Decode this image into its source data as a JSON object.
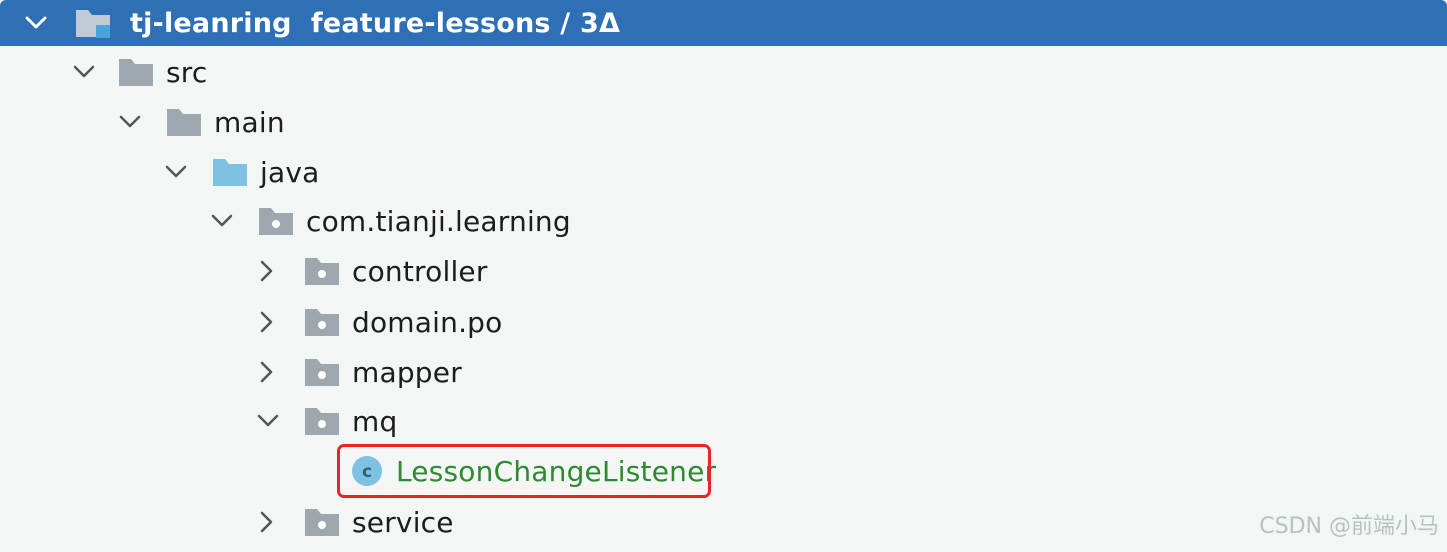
{
  "project": {
    "name": "tj-leanring",
    "branch_label": "feature-lessons / 3Δ"
  },
  "tree": {
    "src": "src",
    "main": "main",
    "java": "java",
    "package": "com.tianji.learning",
    "controller": "controller",
    "domain_po": "domain.po",
    "mapper": "mapper",
    "mq": "mq",
    "listener": "LessonChangeListener",
    "service": "service"
  },
  "icons": {
    "expand": "chevron-down-icon",
    "collapse": "chevron-right-icon",
    "folder": "folder-icon",
    "source_folder": "source-folder-icon",
    "package": "package-icon",
    "class": "java-class-icon"
  },
  "colors": {
    "header_bg": "#2e6fb5",
    "folder": "#9ea7ae",
    "source_folder": "#7fc1e3",
    "class_icon": "#7fc1e3",
    "class_label": "#2f8a2f",
    "highlight": "#e8262a"
  },
  "watermark": "CSDN @前端小马"
}
